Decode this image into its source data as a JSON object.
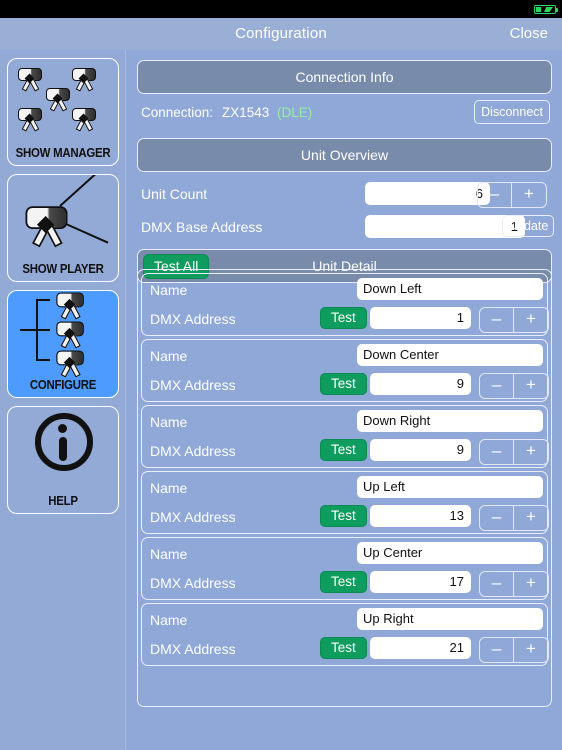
{
  "statusbar": {
    "battery_icon": "battery-charging-icon",
    "battery_color": "#2fd85a"
  },
  "navbar": {
    "title": "Configuration",
    "close_label": "Close"
  },
  "sidebar": {
    "items": [
      {
        "label": "SHOW MANAGER",
        "icon": "multi-projector-icon",
        "selected": false
      },
      {
        "label": "SHOW PLAYER",
        "icon": "projector-beam-icon",
        "selected": false
      },
      {
        "label": "CONFIGURE",
        "icon": "projector-tree-icon",
        "selected": true
      },
      {
        "label": "HELP",
        "icon": "info-circle-icon",
        "selected": false
      }
    ],
    "selected_color": "#4d9bff"
  },
  "main": {
    "connection_info": {
      "header": "Connection Info"
    },
    "connection": {
      "label": "Connection:",
      "name": "ZX1543",
      "state": "(DLE)",
      "state_color": "#8ef0a6",
      "disconnect_label": "Disconnect"
    },
    "unit_overview": {
      "header": "Unit Overview",
      "unit_count": {
        "label": "Unit Count",
        "value": "6",
        "minus": "–",
        "plus": "+"
      },
      "dmx_base": {
        "label": "DMX Base Address",
        "value": "1",
        "update_label": "Update"
      }
    },
    "unit_detail": {
      "header": "Unit Detail",
      "test_all_label": "Test All",
      "test_button_color": "#0e9d5e",
      "name_label": "Name",
      "dmx_label": "DMX Address",
      "test_label": "Test",
      "minus": "–",
      "plus": "+",
      "units": [
        {
          "name": "Down Left",
          "dmx": "1"
        },
        {
          "name": "Down Center",
          "dmx": "9"
        },
        {
          "name": "Down Right",
          "dmx": "9"
        },
        {
          "name": "Up Left",
          "dmx": "13"
        },
        {
          "name": "Up Center",
          "dmx": "17"
        },
        {
          "name": "Up Right",
          "dmx": "21"
        }
      ]
    }
  }
}
